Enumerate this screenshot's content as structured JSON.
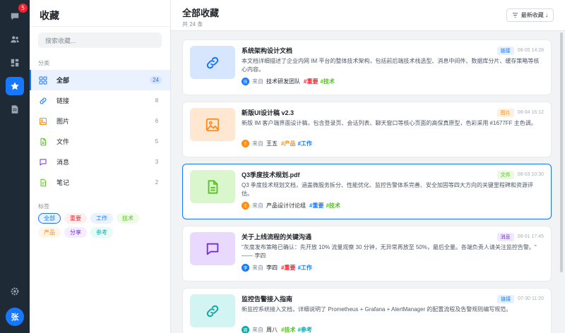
{
  "rail": {
    "badge_count": "5",
    "avatar_text": "张"
  },
  "panel": {
    "title": "收藏",
    "search_placeholder": "搜索收藏...",
    "categories_label": "分类",
    "categories": [
      {
        "label": "全部",
        "count": "24",
        "icon": "grid-icon",
        "color": "#1677ff"
      },
      {
        "label": "链接",
        "count": "8",
        "icon": "link-icon",
        "color": "#1677ff"
      },
      {
        "label": "图片",
        "count": "6",
        "icon": "image-icon",
        "color": "#fa8c16"
      },
      {
        "label": "文件",
        "count": "5",
        "icon": "file-icon",
        "color": "#52c41a"
      },
      {
        "label": "消息",
        "count": "3",
        "icon": "message-icon",
        "color": "#722ed1"
      },
      {
        "label": "笔记",
        "count": "2",
        "icon": "note-icon",
        "color": "#52c41a"
      }
    ],
    "tags_label": "标签",
    "tags": [
      {
        "label": "全部",
        "color": "#1677ff",
        "bg": "#eaf2ff",
        "border": "#1677ff"
      },
      {
        "label": "重要",
        "color": "#f5222d",
        "bg": "#fff0f0",
        "border": "#fff0f0"
      },
      {
        "label": "工作",
        "color": "#1677ff",
        "bg": "#eaf2ff",
        "border": "#eaf2ff"
      },
      {
        "label": "技术",
        "color": "#52c41a",
        "bg": "#effbe8",
        "border": "#effbe8"
      },
      {
        "label": "产品",
        "color": "#fa8c16",
        "bg": "#fff5e8",
        "border": "#fff5e8"
      },
      {
        "label": "分享",
        "color": "#722ed1",
        "bg": "#f4edff",
        "border": "#f4edff"
      },
      {
        "label": "参考",
        "color": "#13a8a8",
        "bg": "#e6fbf8",
        "border": "#e6fbf8"
      }
    ]
  },
  "main": {
    "title": "全部收藏",
    "subtitle": "共 24 条",
    "sort_label": "最新收藏 ↓",
    "items": [
      {
        "title": "系统架构设计文档",
        "type": "链接",
        "type_color": "#1677ff",
        "type_bg": "#e6f0ff",
        "time": "08-05 14:28",
        "desc": "本文档详细描述了企业内网 IM 平台的整体技术架构，包括前后端技术栈选型、消息中间件、数据库分片、缓存策略等核心内容。",
        "from": "来自",
        "source": "技术研发团队",
        "avatar": "技",
        "avatar_color": "#1677ff",
        "tags": [
          {
            "text": "#重要",
            "color": "#f5222d"
          },
          {
            "text": "#技术",
            "color": "#52c41a"
          }
        ],
        "icon": "link-icon",
        "thumb_bg": "#d6e6ff",
        "icon_color": "#1677ff"
      },
      {
        "title": "新版UI设计稿 v2.3",
        "type": "图片",
        "type_color": "#fa8c16",
        "type_bg": "#fff1e0",
        "time": "08-04 16:12",
        "desc": "新版 IM 客户端界面设计稿，包含登录页、会话列表、聊天窗口等核心页面的高保真原型，色彩采用 #1677FF 主色调。",
        "from": "来自",
        "source": "王五",
        "avatar": "王",
        "avatar_color": "#fa8c16",
        "tags": [
          {
            "text": "#产品",
            "color": "#fa8c16"
          },
          {
            "text": "#工作",
            "color": "#1677ff"
          }
        ],
        "icon": "image-icon",
        "thumb_bg": "#ffe7d1",
        "icon_color": "#fa8c16"
      },
      {
        "title": "Q3季度技术规划.pdf",
        "type": "文件",
        "type_color": "#52c41a",
        "type_bg": "#ebf9e3",
        "time": "08-03 10:30",
        "desc": "Q3 季度技术规划文档，涵盖微服务拆分、性能优化、监控告警体系完善、安全加固等四大方向的关键里程碑和资源评估。",
        "from": "来自",
        "source": "产品设计讨论组",
        "avatar": "王",
        "avatar_color": "#fa8c16",
        "tags": [
          {
            "text": "#重要",
            "color": "#1677ff"
          },
          {
            "text": "#技术",
            "color": "#52c41a"
          }
        ],
        "icon": "file-icon",
        "thumb_bg": "#d9f6cc",
        "icon_color": "#52c41a"
      },
      {
        "title": "关于上线流程的关键沟通",
        "type": "消息",
        "type_color": "#722ed1",
        "type_bg": "#f1e8ff",
        "time": "08-01 17:45",
        "desc": "\"灰度发布策略已确认：先开放 10% 流量观察 30 分钟，无异常再放至 50%，最后全量。各端负责人请关注监控告警。\" —— 李四",
        "from": "来自",
        "source": "李四",
        "avatar": "李",
        "avatar_color": "#1677ff",
        "tags": [
          {
            "text": "#重要",
            "color": "#f5222d"
          },
          {
            "text": "#工作",
            "color": "#1677ff"
          }
        ],
        "icon": "message-icon",
        "thumb_bg": "#ead9ff",
        "icon_color": "#722ed1"
      },
      {
        "title": "监控告警接入指南",
        "type": "链接",
        "type_color": "#1677ff",
        "type_bg": "#e6f0ff",
        "time": "07-30 11:20",
        "desc": "新监控系统接入文档，详细说明了 Prometheus + Grafana + AlertManager 的配置流程及告警规则编写规范。",
        "from": "来自",
        "source": "周八",
        "avatar": "周",
        "avatar_color": "#13a8a8",
        "tags": [
          {
            "text": "#技术",
            "color": "#52c41a"
          },
          {
            "text": "#参考",
            "color": "#13a8a8"
          }
        ],
        "icon": "link-icon",
        "thumb_bg": "#d2f4f2",
        "icon_color": "#13a8a8"
      }
    ]
  }
}
